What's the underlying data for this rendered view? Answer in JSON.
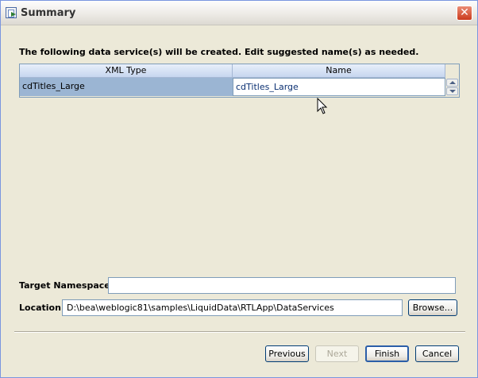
{
  "window": {
    "title": "Summary"
  },
  "instructions": "The following data service(s) will be created.  Edit suggested name(s) as needed.",
  "table": {
    "columns": [
      "XML Type",
      "Name"
    ],
    "rows": [
      {
        "xml_type": "cdTitles_Large",
        "name": "cdTitles_Large"
      }
    ]
  },
  "form": {
    "target_namespace_label": "Target Namespace",
    "target_namespace_value": "",
    "location_label": "Location",
    "location_value": "D:\\bea\\weblogic81\\samples\\LiquidData\\RTLApp\\DataServices",
    "browse_label": "Browse..."
  },
  "buttons": {
    "previous": "Previous",
    "next": "Next",
    "finish": "Finish",
    "cancel": "Cancel"
  },
  "colors": {
    "selected_row": "#9bb5d3",
    "header_bg": "#c6d6ef",
    "dialog_bg": "#ece9d8",
    "close_button": "#cb3a1c"
  }
}
